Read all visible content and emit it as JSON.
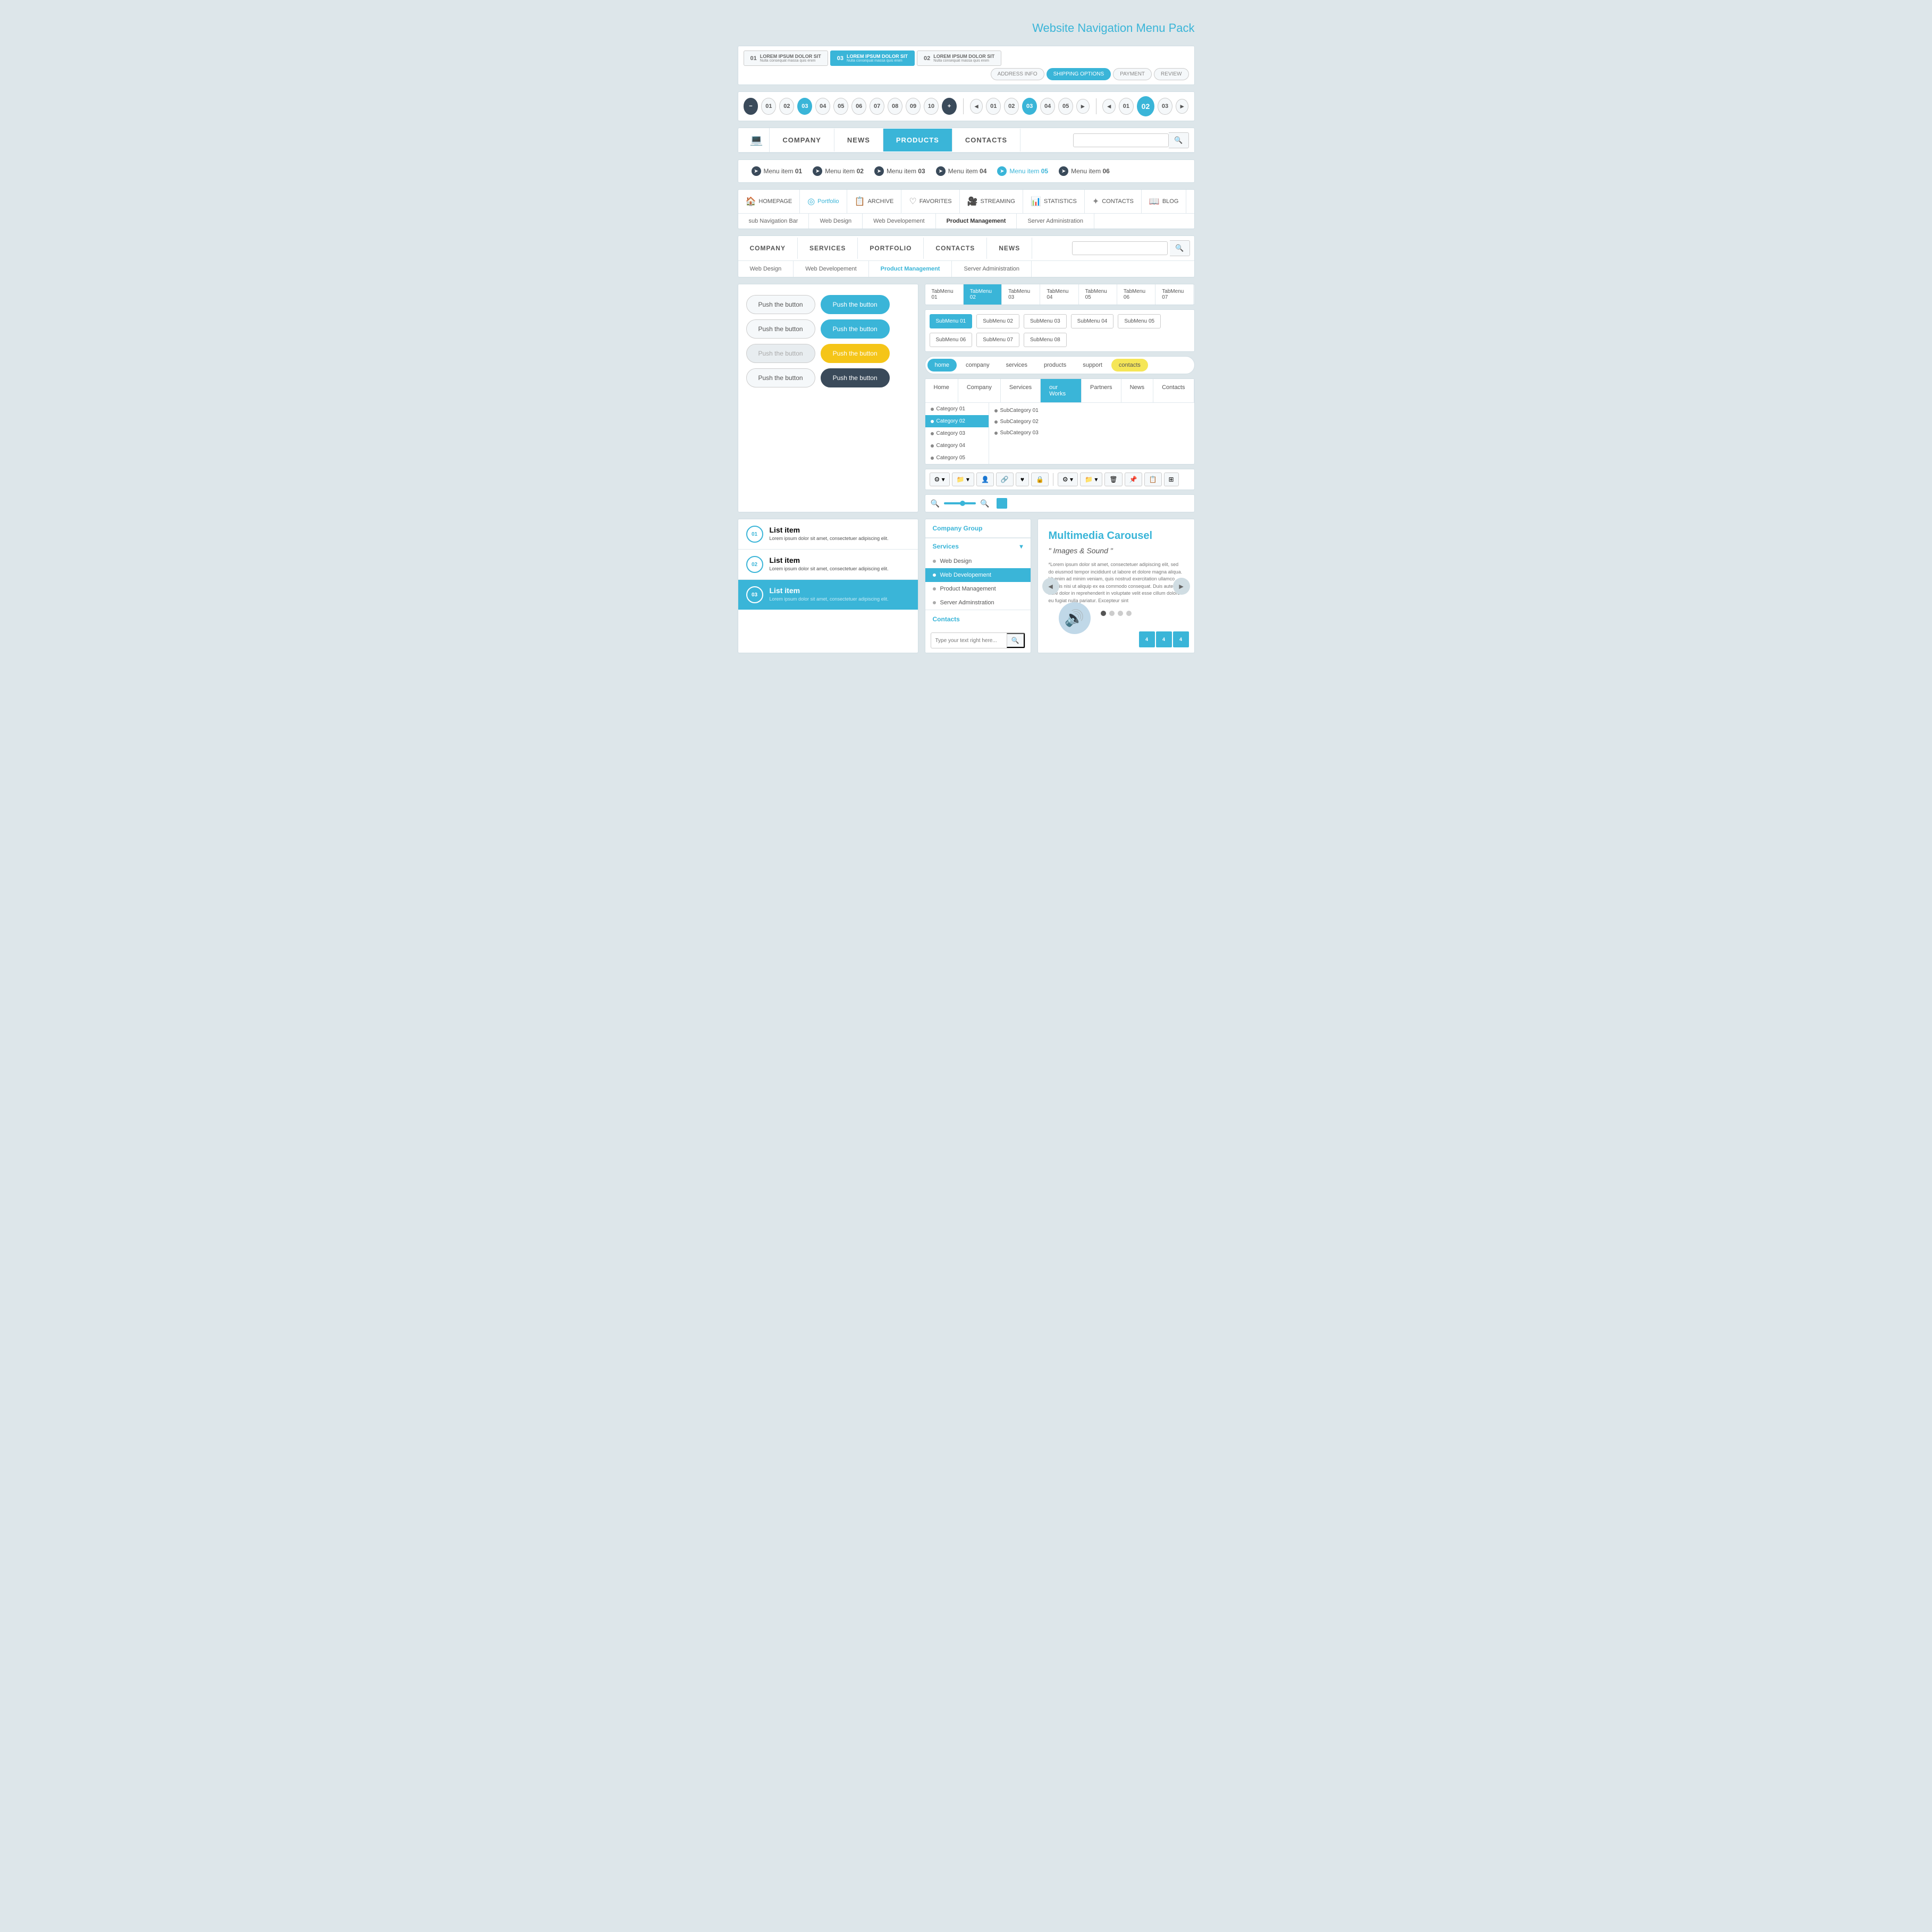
{
  "page": {
    "title": "Website Navigation Menu Pack"
  },
  "step_bar": {
    "steps": [
      {
        "num": "01",
        "main": "LOREM IPSUM DOLOR SIT",
        "sub": "Nulla consequat massa quis enim"
      },
      {
        "num": "03",
        "main": "LOREM IPSUM DOLOR SIT",
        "sub": "Nulla consequat massa quis enim",
        "active": true
      },
      {
        "num": "02",
        "main": "LOREM IPSUM DOLOR SIT",
        "sub": "Nulla consequat massa quis enim"
      }
    ],
    "checkout_steps": [
      "ADDRESS INFO",
      "SHIPPING OPTIONS",
      "PAYMENT",
      "REVIEW"
    ]
  },
  "pagination1": {
    "items": [
      "-",
      "01",
      "02",
      "03",
      "04",
      "05",
      "06",
      "07",
      "08",
      "09",
      "10",
      "+"
    ],
    "active": "03"
  },
  "pagination2": {
    "items": [
      "◄",
      "01",
      "02",
      "03",
      "04",
      "05",
      "►"
    ],
    "active": "03"
  },
  "pagination3": {
    "items": [
      "◄",
      "01",
      "02",
      "03",
      "►"
    ],
    "active": "02"
  },
  "main_nav": {
    "items": [
      "COMPANY",
      "NEWS",
      "PRODUCTS",
      "CONTACTS"
    ],
    "active": "PRODUCTS",
    "search_placeholder": ""
  },
  "menu_items": [
    {
      "label": "Menu item",
      "num": "01"
    },
    {
      "label": "Menu item",
      "num": "02"
    },
    {
      "label": "Menu item",
      "num": "03"
    },
    {
      "label": "Menu item",
      "num": "04"
    },
    {
      "label": "Menu item",
      "num": "05",
      "highlight": true
    },
    {
      "label": "Menu item",
      "num": "06"
    }
  ],
  "icon_nav": {
    "items": [
      {
        "icon": "🏠",
        "label": "HOMEPAGE"
      },
      {
        "icon": "◎",
        "label": "Portfolio",
        "active": true
      },
      {
        "icon": "📋",
        "label": "ARCHIVE"
      },
      {
        "icon": "♡",
        "label": "FAVORITES"
      },
      {
        "icon": "🎥",
        "label": "STREAMING"
      },
      {
        "icon": "📊",
        "label": "STATISTICS"
      },
      {
        "icon": "✦",
        "label": "CONTACTS"
      },
      {
        "icon": "📖",
        "label": "BLOG"
      }
    ],
    "sub_items": [
      {
        "label": "sub Navigation Bar"
      },
      {
        "label": "Web Design"
      },
      {
        "label": "Web Developement"
      },
      {
        "label": "Product Management",
        "active": true
      },
      {
        "label": "Server Administration"
      }
    ]
  },
  "main_nav2": {
    "items": [
      "COMPANY",
      "SERVICES",
      "PORTFOLIO",
      "CONTACTS",
      "NEWS"
    ],
    "sub_items": [
      {
        "label": "Web Design"
      },
      {
        "label": "Web Developement"
      },
      {
        "label": "Product Management",
        "active": true
      },
      {
        "label": "Server Administration"
      }
    ]
  },
  "tab_menus": {
    "tabs": [
      "TabMenu 01",
      "TabMenu 02",
      "TabMenu 03",
      "TabMenu 04",
      "TabMenu 05",
      "TabMenu 06",
      "TabMenu 07"
    ],
    "active_tab": "TabMenu 02",
    "subs": [
      "SubMenu 01",
      "SubMenu 02",
      "SubMenu 03",
      "SubMenu 04",
      "SubMenu 05",
      "SubMenu 06",
      "SubMenu 07",
      "SubMenu 08"
    ],
    "active_sub": "SubMenu 01"
  },
  "pill_nav": {
    "items": [
      "home",
      "company",
      "services",
      "products",
      "support",
      "contacts"
    ],
    "active_cyan": "home",
    "active_yellow": "contacts"
  },
  "dropdown_nav": {
    "top_items": [
      "Home",
      "Company",
      "Services",
      "our Works",
      "Partners",
      "News",
      "Contacts"
    ],
    "active_top": "our Works",
    "categories": [
      "Category 01",
      "Category 02",
      "Category 03",
      "Category 04",
      "Category 05"
    ],
    "active_cat": "Category 02",
    "sub_categories": [
      "SubCategory 01",
      "SubCategory 02",
      "SubCategory 03"
    ]
  },
  "buttons": {
    "rows": [
      {
        "left": {
          "label": "Push the button",
          "style": "default"
        },
        "right": {
          "label": "Push the button",
          "style": "cyan"
        }
      },
      {
        "left": {
          "label": "Push the button",
          "style": "default"
        },
        "right": {
          "label": "Push the button",
          "style": "cyan"
        }
      },
      {
        "left": {
          "label": "Push the button",
          "style": "disabled"
        },
        "right": {
          "label": "Push the button",
          "style": "yellow"
        }
      },
      {
        "left": {
          "label": "Push the button",
          "style": "default"
        },
        "right": {
          "label": "Push the button",
          "style": "dark"
        }
      }
    ]
  },
  "list_items": [
    {
      "num": "01",
      "title": "List item",
      "desc": "Lorem ipsum dolor sit amet, consectetuer adipiscing elit."
    },
    {
      "num": "02",
      "title": "List item",
      "desc": "Lorem ipsum dolor sit amet, consectetuer adipiscing elit."
    },
    {
      "num": "03",
      "title": "List item",
      "desc": "Lorem ipsum dolor sit amet, consectetuer adipiscing elit.",
      "active": true
    }
  ],
  "sidebar": {
    "group_title": "Company Group",
    "services_label": "Services",
    "sub_items": [
      "Web Design",
      "Web Developement",
      "Product Management",
      "Server Adminstration"
    ],
    "active_sub": "Web Developement",
    "contacts_label": "Contacts",
    "search_placeholder": "Type your text right here..."
  },
  "carousel": {
    "title": "Multimedia Carousel",
    "subtitle": "\" Images & Sound \"",
    "text": "*Lorem ipsum dolor sit amet, consectetuer adipiscing elit, sed do eiusmod tempor incididunt ut labore et dolore magna aliqua. Ut enim ad minim veniam, quis nostrud exercitation ullamco laboris nisi ut aliquip ex ea commodo consequat. Duis aute irure dolor in reprehenderit in voluptate velit esse cillum dolore eu fugiat nulla pariatur. Excepteur sint",
    "dots": [
      false,
      false,
      false,
      false
    ],
    "film_frames": [
      "4",
      "4",
      "4"
    ]
  }
}
